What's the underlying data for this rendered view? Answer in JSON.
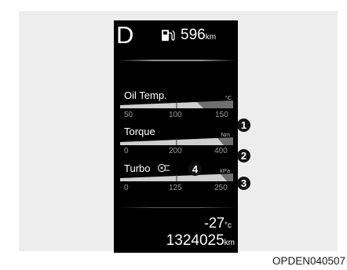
{
  "display": {
    "gear": "D",
    "range": {
      "value": "596",
      "unit": "km"
    },
    "outside_temp": {
      "value": "-27",
      "unit": "°c"
    },
    "odometer": {
      "value": "1324025",
      "unit": "km"
    }
  },
  "gauges": [
    {
      "label": "Oil Temp.",
      "unit": "°C",
      "ticks": [
        "50",
        "100",
        "150"
      ]
    },
    {
      "label": "Torque",
      "unit": "Nm",
      "ticks": [
        "0",
        "200",
        "400"
      ]
    },
    {
      "label": "Turbo",
      "unit": "kPa",
      "ticks": [
        "0",
        "125",
        "250"
      ]
    }
  ],
  "callouts": [
    "1",
    "2",
    "3",
    "4"
  ],
  "caption": "OPDEN040507",
  "colors": {
    "screen_bg": "#000000",
    "panel_bg": "#ededed",
    "gauge_track": "#7d7d7d",
    "gauge_fill": "#c8c8c8",
    "text": "#ffffff"
  }
}
